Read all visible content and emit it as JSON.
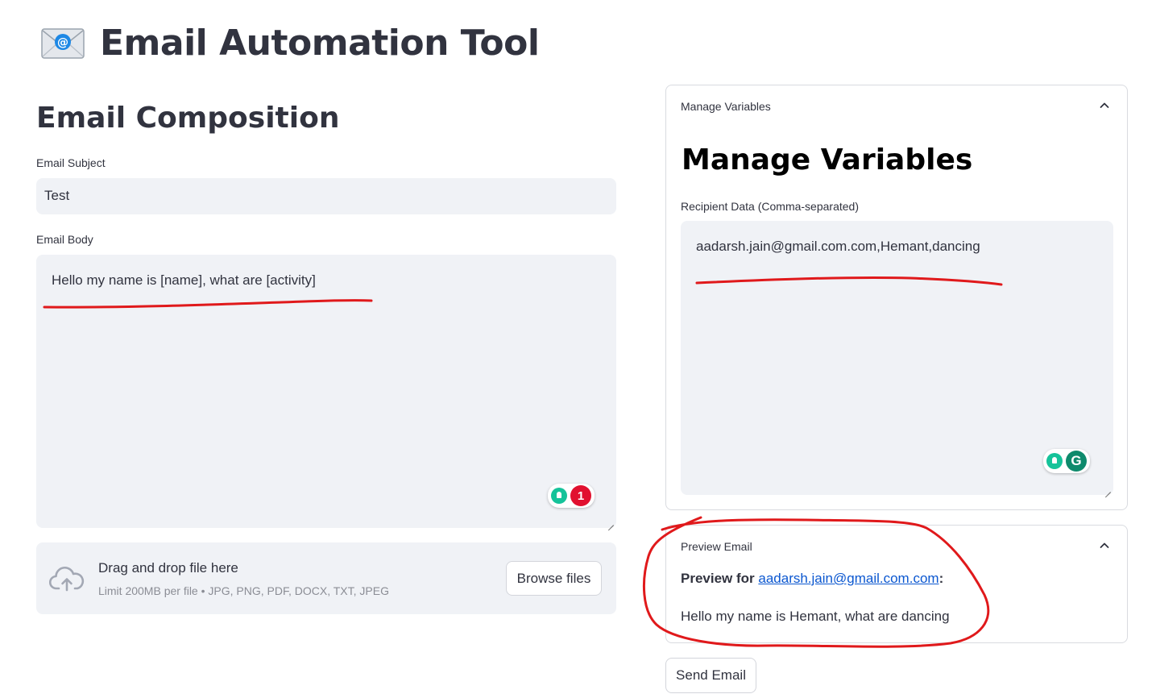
{
  "app": {
    "title": "Email Automation Tool",
    "icon": "envelope-at-icon"
  },
  "composition": {
    "heading": "Email Composition",
    "subject_label": "Email Subject",
    "subject_value": "Test",
    "body_label": "Email Body",
    "body_value": "Hello my name is [name], what are [activity]",
    "grammarly_count": "1"
  },
  "uploader": {
    "main_text": "Drag and drop file here",
    "sub_text": "Limit 200MB per file • JPG, PNG, PDF, DOCX, TXT, JPEG",
    "browse_label": "Browse files",
    "icon": "cloud-upload-icon"
  },
  "variables": {
    "expander_label": "Manage Variables",
    "heading": "Manage Variables",
    "recipient_label": "Recipient Data (Comma-separated)",
    "recipient_value": "aadarsh.jain@gmail.com.com,Hemant,dancing",
    "grammarly_logo": "G"
  },
  "preview": {
    "expander_label": "Preview Email",
    "prefix": "Preview for ",
    "recipient": "aadarsh.jain@gmail.com.com",
    "suffix": ":",
    "body": "Hello my name is Hemant, what are dancing"
  },
  "actions": {
    "send_label": "Send Email"
  },
  "colors": {
    "field_bg": "#f0f2f6",
    "text": "#31333f",
    "annotation": "#e0191b",
    "link": "#0b57d0",
    "grammarly_green": "#15c39a",
    "grammarly_red": "#e1102f"
  }
}
